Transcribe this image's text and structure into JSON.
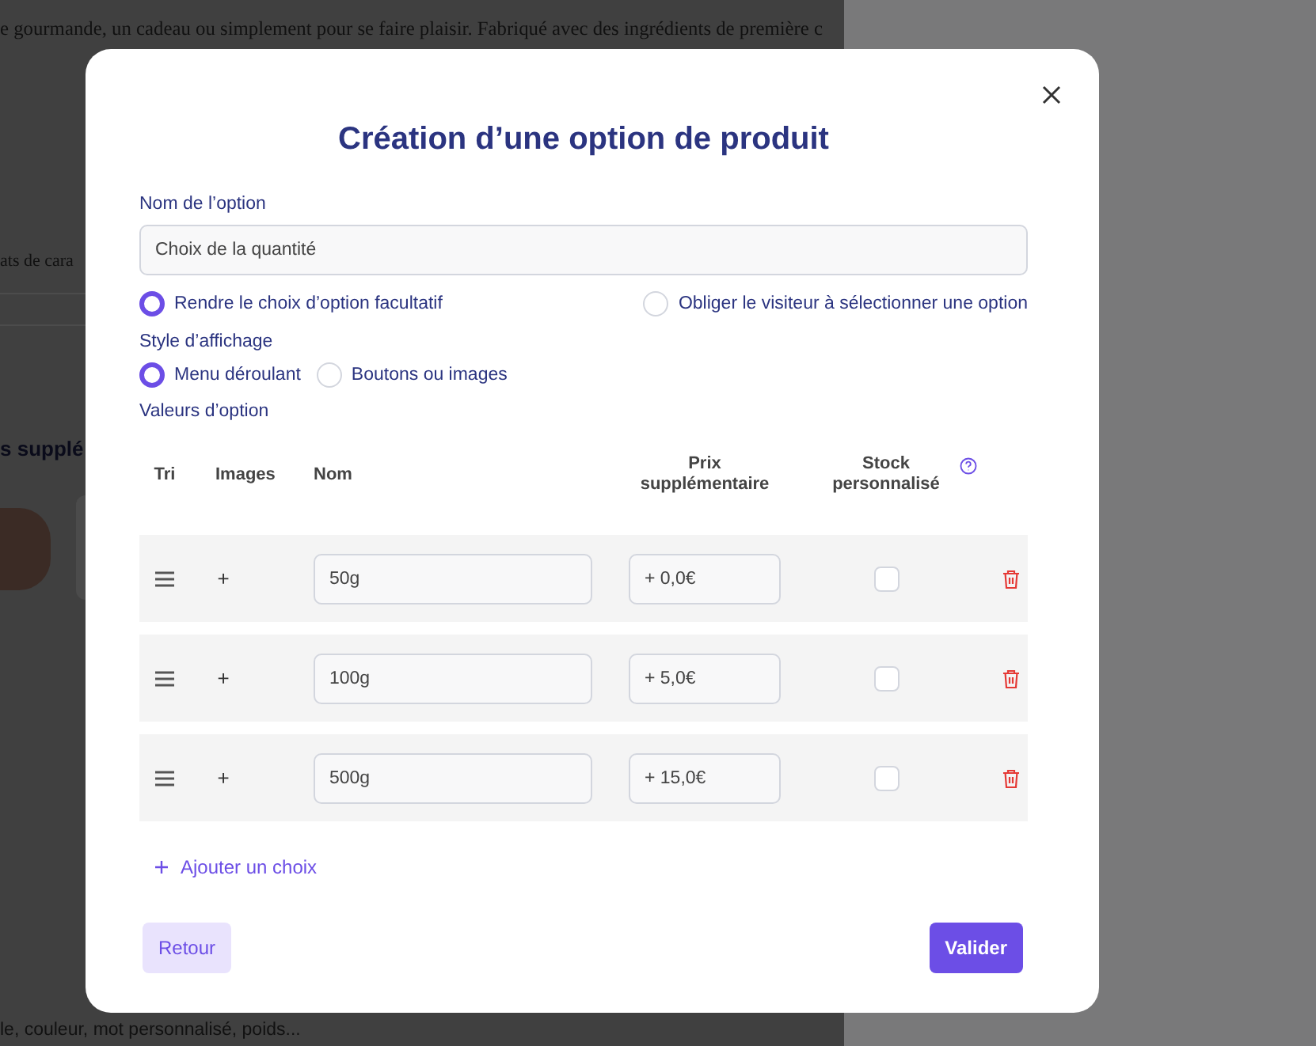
{
  "background_page": {
    "intro_text": "e gourmande, un cadeau ou simplement pour se faire plaisir. Fabriqué avec des ingrédients de première c",
    "side_text": "ats de cara",
    "section_heading": "s supplé",
    "footer_text": "le, couleur, mot personnalisé, poids..."
  },
  "modal": {
    "title": "Création d’une option de produit",
    "option_name": {
      "label": "Nom de l’option",
      "value": "Choix de la quantité"
    },
    "requirement": [
      {
        "label": "Rendre le choix d’option facultatif",
        "selected": true
      },
      {
        "label": "Obliger le visiteur à sélectionner une option",
        "selected": false
      }
    ],
    "display_style": {
      "label": "Style d’affichage",
      "options": [
        {
          "label": "Menu déroulant",
          "selected": true
        },
        {
          "label": "Boutons ou images",
          "selected": false
        }
      ]
    },
    "values": {
      "label": "Valeurs d’option",
      "columns": [
        "Tri",
        "Images",
        "Nom",
        "Prix supplémentaire",
        "Stock personnalisé"
      ],
      "rows": [
        {
          "image_button": "+",
          "name": "50g",
          "price": "+ 0,0€",
          "custom_stock": false
        },
        {
          "image_button": "+",
          "name": "100g",
          "price": "+ 5,0€",
          "custom_stock": false
        },
        {
          "image_button": "+",
          "name": "500g",
          "price": "+ 15,0€",
          "custom_stock": false
        }
      ],
      "add_button": "Ajouter un choix"
    },
    "buttons": {
      "back": "Retour",
      "submit": "Valider"
    }
  }
}
